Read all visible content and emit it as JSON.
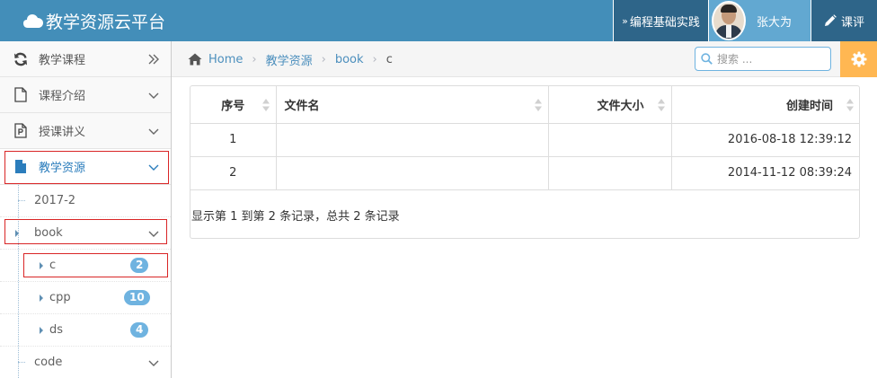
{
  "header": {
    "brand": "教学资源云平台",
    "practice_label": "编程基础实践",
    "user_name": "张大为",
    "review_label": "课评",
    "accent": "#438eb9"
  },
  "sidebar": {
    "items": [
      {
        "label": "教学课程",
        "icon": "refresh-icon"
      },
      {
        "label": "课程介绍",
        "icon": "file-icon"
      },
      {
        "label": "授课讲义",
        "icon": "ppt-file-icon"
      },
      {
        "label": "教学资源",
        "icon": "file-solid-icon"
      }
    ],
    "sub": {
      "folder_2017": "2017-2",
      "book": "book",
      "c": "c",
      "c_count": "2",
      "cpp": "cpp",
      "cpp_count": "10",
      "ds": "ds",
      "ds_count": "4",
      "code": "code"
    }
  },
  "breadcrumb": {
    "home": "Home",
    "level1": "教学资源",
    "level2": "book",
    "current": "c"
  },
  "search": {
    "placeholder": "搜索 ..."
  },
  "table": {
    "headers": [
      "序号",
      "文件名",
      "文件大小",
      "创建时间"
    ],
    "rows": [
      {
        "index": "1",
        "name": "",
        "size": "",
        "created": "2016-08-18 12:39:12"
      },
      {
        "index": "2",
        "name": "",
        "size": "",
        "created": "2014-11-12 08:39:24"
      }
    ],
    "info": "显示第 1 到第 2 条记录，总共 2 条记录"
  }
}
